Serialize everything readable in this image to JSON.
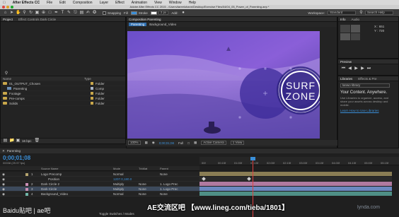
{
  "menubar": {
    "app": "After Effects CC",
    "items": [
      "File",
      "Edit",
      "Composition",
      "Layer",
      "Effect",
      "Animation",
      "View",
      "Window",
      "Help"
    ]
  },
  "titlebar": {
    "text": "Adobe After Effects CC 2015 - /Users/tareelohann/Desktop/Exercise Files/04/04_05_Power_of_Parenting.aep *"
  },
  "toolbar": {
    "snapping": "Snapping",
    "fill": "Fill",
    "stroke": "Stroke",
    "stroke_width": "2 px",
    "add": "Add:",
    "workspace_label": "Workspace:",
    "workspace_value": "Standard",
    "search": "Search Help"
  },
  "project": {
    "tabs": [
      "Project",
      "Effect Controls Dark Circle"
    ],
    "columns": {
      "name": "Name",
      "type": "Type"
    },
    "items": [
      {
        "name": "01_OUTPUT_Chosen",
        "type": "Folder",
        "kind": "folder"
      },
      {
        "name": "Parenting",
        "type": "Comp",
        "kind": "comp"
      },
      {
        "name": "Footage",
        "type": "Folder",
        "kind": "folder"
      },
      {
        "name": "Pre-comps",
        "type": "Folder",
        "kind": "folder"
      },
      {
        "name": "Solids",
        "type": "Folder",
        "kind": "folder"
      }
    ],
    "bpc": "16 bpc"
  },
  "viewer": {
    "tab": "Composition Parenting",
    "breadcrumbs": [
      "Parenting",
      "Background_Video"
    ],
    "logo_line1": "SURF",
    "logo_line2": "ZONE",
    "zoom": "100%",
    "time": "0;00;01;08",
    "resolution": "Full",
    "camera": "Active Camera",
    "views": "1 View"
  },
  "info": {
    "tabs": [
      "Info",
      "Audio"
    ],
    "x": "X : 651",
    "y": "Y : 720"
  },
  "preview": {
    "tab": "Preview"
  },
  "libraries": {
    "tabs": [
      "Libraries",
      "Effects & Pre"
    ],
    "library": "lanwo library",
    "heading": "Your Content. Anywhere.",
    "body": "Use Libraries to organize, access, and share your assets across desktop and mobile.",
    "link": "Learn How to Use Libraries"
  },
  "timeline": {
    "tab": "Parenting",
    "timecode": "0;00;01;08",
    "timecode_sub": "00038 (29.97 fps)",
    "columns": {
      "source": "Source Name",
      "mode": "Mode",
      "trkmat": "TrkMat",
      "parent": "Parent"
    },
    "layers": [
      {
        "num": "1",
        "name": "Logo Precomp",
        "mode": "Normal",
        "trkmat": "",
        "parent": "None",
        "color": "#b5a46e"
      },
      {
        "num": "",
        "name": "Position",
        "mode": "1207.0,180.0",
        "trkmat": "",
        "parent": "",
        "color": ""
      },
      {
        "num": "2",
        "name": "Dark Circle 2",
        "mode": "Multiply",
        "trkmat": "None",
        "parent": "1. Logo Prec",
        "color": "#c98fb5"
      },
      {
        "num": "3",
        "name": "Dark Circle",
        "mode": "Multiply",
        "trkmat": "None",
        "parent": "1. Logo Prec",
        "color": "#c98fb5"
      },
      {
        "num": "4",
        "name": "Background_Video",
        "mode": "Normal",
        "trkmat": "None",
        "parent": "None",
        "color": "#6fb5a8"
      }
    ],
    "ticks": [
      "00f",
      "00:15f",
      "01:00f",
      "01:15f",
      "02:00f",
      "02:15f",
      "03:00f",
      "03:15f",
      "04:00f",
      "04:15f",
      "05:00f",
      "05:15f"
    ],
    "switches_label": "Toggle Switches / Modes"
  },
  "watermarks": {
    "baidu": "Baidu贴吧 | ae吧",
    "center": "AE交流区吧 【www.lineg.com/tieba/1801】",
    "corner": "lynda.com"
  }
}
